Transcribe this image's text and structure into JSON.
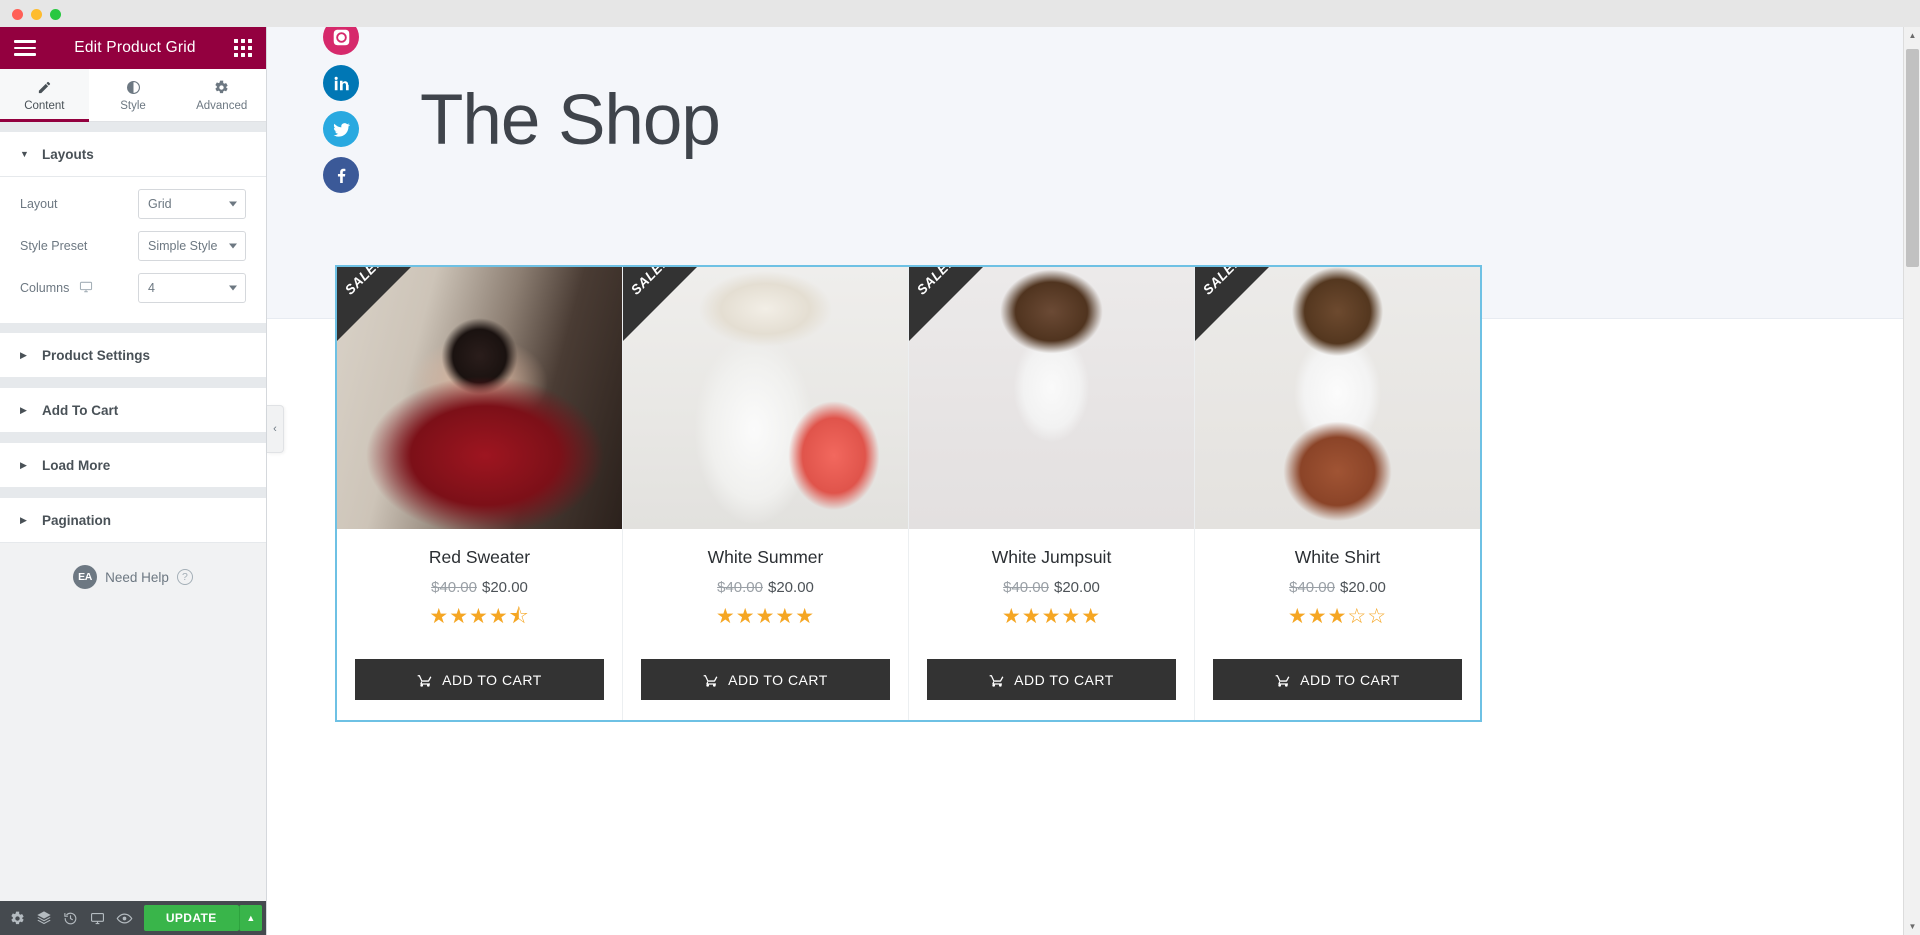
{
  "window": {
    "traffic_lights": [
      "close",
      "minimize",
      "maximize"
    ]
  },
  "panel": {
    "title": "Edit Product Grid",
    "menu_icon": "hamburger-icon",
    "apps_icon": "grid-apps-icon",
    "tabs": [
      {
        "label": "Content",
        "icon": "pencil-icon",
        "active": true
      },
      {
        "label": "Style",
        "icon": "contrast-icon",
        "active": false
      },
      {
        "label": "Advanced",
        "icon": "gear-icon",
        "active": false
      }
    ],
    "sections": [
      {
        "title": "Layouts",
        "expanded": true
      },
      {
        "title": "Product Settings",
        "expanded": false
      },
      {
        "title": "Add To Cart",
        "expanded": false
      },
      {
        "title": "Load More",
        "expanded": false
      },
      {
        "title": "Pagination",
        "expanded": false
      }
    ],
    "controls": [
      {
        "label": "Layout",
        "value": "Grid",
        "device_icon": null
      },
      {
        "label": "Style Preset",
        "value": "Simple Style",
        "device_icon": null
      },
      {
        "label": "Columns",
        "value": "4",
        "device_icon": "desktop-icon"
      }
    ],
    "need_help": {
      "badge": "EA",
      "label": "Need Help",
      "help_icon": "?"
    },
    "footer": {
      "icons": [
        "settings-gear-icon",
        "layers-navigator-icon",
        "history-icon",
        "responsive-mode-icon",
        "preview-eye-icon"
      ],
      "update_label": "UPDATE",
      "update_caret": "▲",
      "update_color": "#39b54a"
    },
    "collapse_handle": "‹",
    "accent_color": "#93003f"
  },
  "canvas": {
    "hero": {
      "title": "The Shop",
      "socials": [
        {
          "name": "instagram",
          "color": "#d6296b"
        },
        {
          "name": "linkedin",
          "color": "#0077b5"
        },
        {
          "name": "twitter",
          "color": "#29a9e0"
        },
        {
          "name": "facebook",
          "color": "#3b5998"
        }
      ]
    },
    "widget": {
      "selected": true,
      "selection_color": "#6ec1e4",
      "badge_label": "SALE!",
      "cart_label": "ADD TO CART",
      "products": [
        {
          "name": "Red Sweater",
          "old_price": "$40.00",
          "price": "$20.00",
          "rating": 4.5,
          "on_sale": true,
          "image": "woman-in-red-sweater"
        },
        {
          "name": "White Summer",
          "old_price": "$40.00",
          "price": "$20.00",
          "rating": 5,
          "on_sale": true,
          "image": "woman-with-shopping-bags"
        },
        {
          "name": "White Jumpsuit",
          "old_price": "$40.00",
          "price": "$20.00",
          "rating": 5,
          "on_sale": true,
          "image": "woman-in-jumpsuit"
        },
        {
          "name": "White Shirt",
          "old_price": "$40.00",
          "price": "$20.00",
          "rating": 3,
          "on_sale": true,
          "image": "woman-in-white-shirt"
        }
      ]
    }
  },
  "scrollbar": {
    "up": "▲",
    "down": "▼",
    "position": "near-top"
  }
}
